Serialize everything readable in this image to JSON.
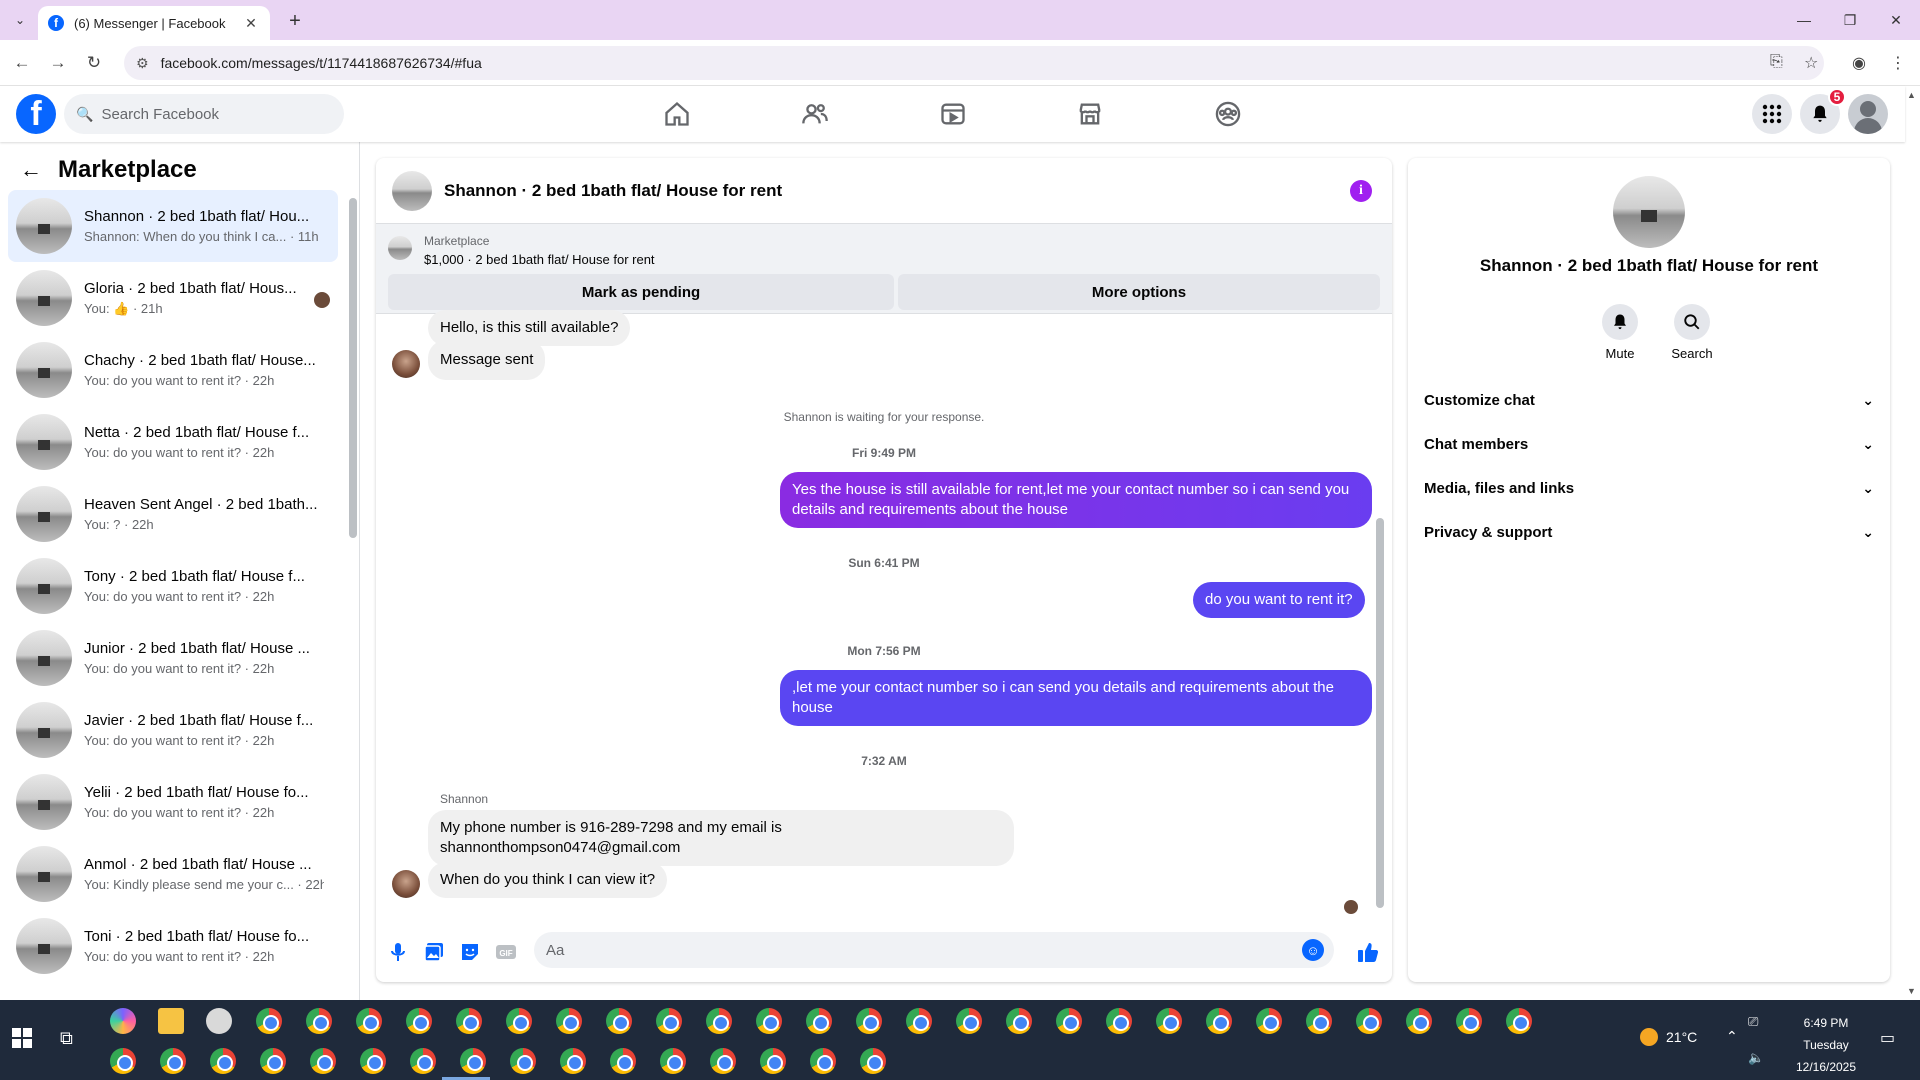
{
  "browser": {
    "tab_title": "(6) Messenger | Facebook",
    "url": "facebook.com/messages/t/1174418687626734/#fua",
    "new_tab": "+",
    "close_tab": "✕"
  },
  "fb": {
    "logo": "f",
    "search_placeholder": "Search Facebook",
    "notification_count": "5",
    "nav_icons": [
      "home-icon",
      "friends-icon",
      "video-icon",
      "marketplace-icon",
      "groups-icon"
    ]
  },
  "sidebar": {
    "title": "Marketplace",
    "conversations": [
      {
        "name": "Shannon · 2 bed 1bath flat/ Hou...",
        "snippet": "Shannon: When do you think I ca... · 11h",
        "active": true
      },
      {
        "name": "Gloria · 2 bed 1bath flat/ Hous...",
        "snippet": "You: 👍 · 21h",
        "seen": true
      },
      {
        "name": "Chachy · 2 bed 1bath flat/ House...",
        "snippet": "You: do you want to rent it? · 22h"
      },
      {
        "name": "Netta · 2 bed 1bath flat/ House f...",
        "snippet": "You: do you want to rent it? · 22h"
      },
      {
        "name": "Heaven Sent Angel · 2 bed 1bath...",
        "snippet": "You: ? · 22h"
      },
      {
        "name": "Tony · 2 bed 1bath flat/ House f...",
        "snippet": "You: do you want to rent it? · 22h"
      },
      {
        "name": "Junior · 2 bed 1bath flat/ House ...",
        "snippet": "You: do you want to rent it? · 22h"
      },
      {
        "name": "Javier · 2 bed 1bath flat/ House f...",
        "snippet": "You: do you want to rent it? · 22h"
      },
      {
        "name": "Yelii · 2 bed 1bath flat/ House fo...",
        "snippet": "You: do you want to rent it? · 22h"
      },
      {
        "name": "Anmol · 2 bed 1bath flat/ House ...",
        "snippet": "You: Kindly please send me your c... · 22h"
      },
      {
        "name": "Toni · 2 bed 1bath flat/ House fo...",
        "snippet": "You: do you want to rent it? · 22h"
      }
    ]
  },
  "chat": {
    "title": "Shannon · 2 bed 1bath flat/ House for rent",
    "marketplace_label": "Marketplace",
    "listing": "$1,000 · 2 bed 1bath flat/ House for rent",
    "mark_pending": "Mark as pending",
    "more_options": "More options",
    "messages": {
      "m1": "Hello, is this still available?",
      "m2": "Message sent",
      "waiting": "Shannon is waiting for your response.",
      "t1": "Fri 9:49 PM",
      "m3": "Yes the house is still available for rent,let me your contact number so i can send you details and requirements about the house",
      "t2": "Sun 6:41 PM",
      "m4": "do you want to rent it?",
      "t3": "Mon 7:56 PM",
      "m5": ",let me your contact number so i can send you details and requirements about the house",
      "t4": "7:32 AM",
      "sender": "Shannon",
      "m6": "My phone number is 916-289-7298 and my email is shannonthompson0474@gmail.com",
      "m7": "When do you think I can view it?"
    },
    "composer_placeholder": "Aa"
  },
  "info_panel": {
    "name": "Shannon · 2 bed 1bath flat/ House for rent",
    "mute": "Mute",
    "search": "Search",
    "sections": [
      "Customize chat",
      "Chat members",
      "Media, files and links",
      "Privacy & support"
    ]
  },
  "taskbar": {
    "temperature": "21°C",
    "time": "6:49 PM",
    "day": "Tuesday",
    "date": "12/16/2025"
  },
  "colors": {
    "fb_blue": "#0866ff",
    "outgoing_bubble": "#7b3ff2",
    "badge_red": "#e41e3f"
  }
}
